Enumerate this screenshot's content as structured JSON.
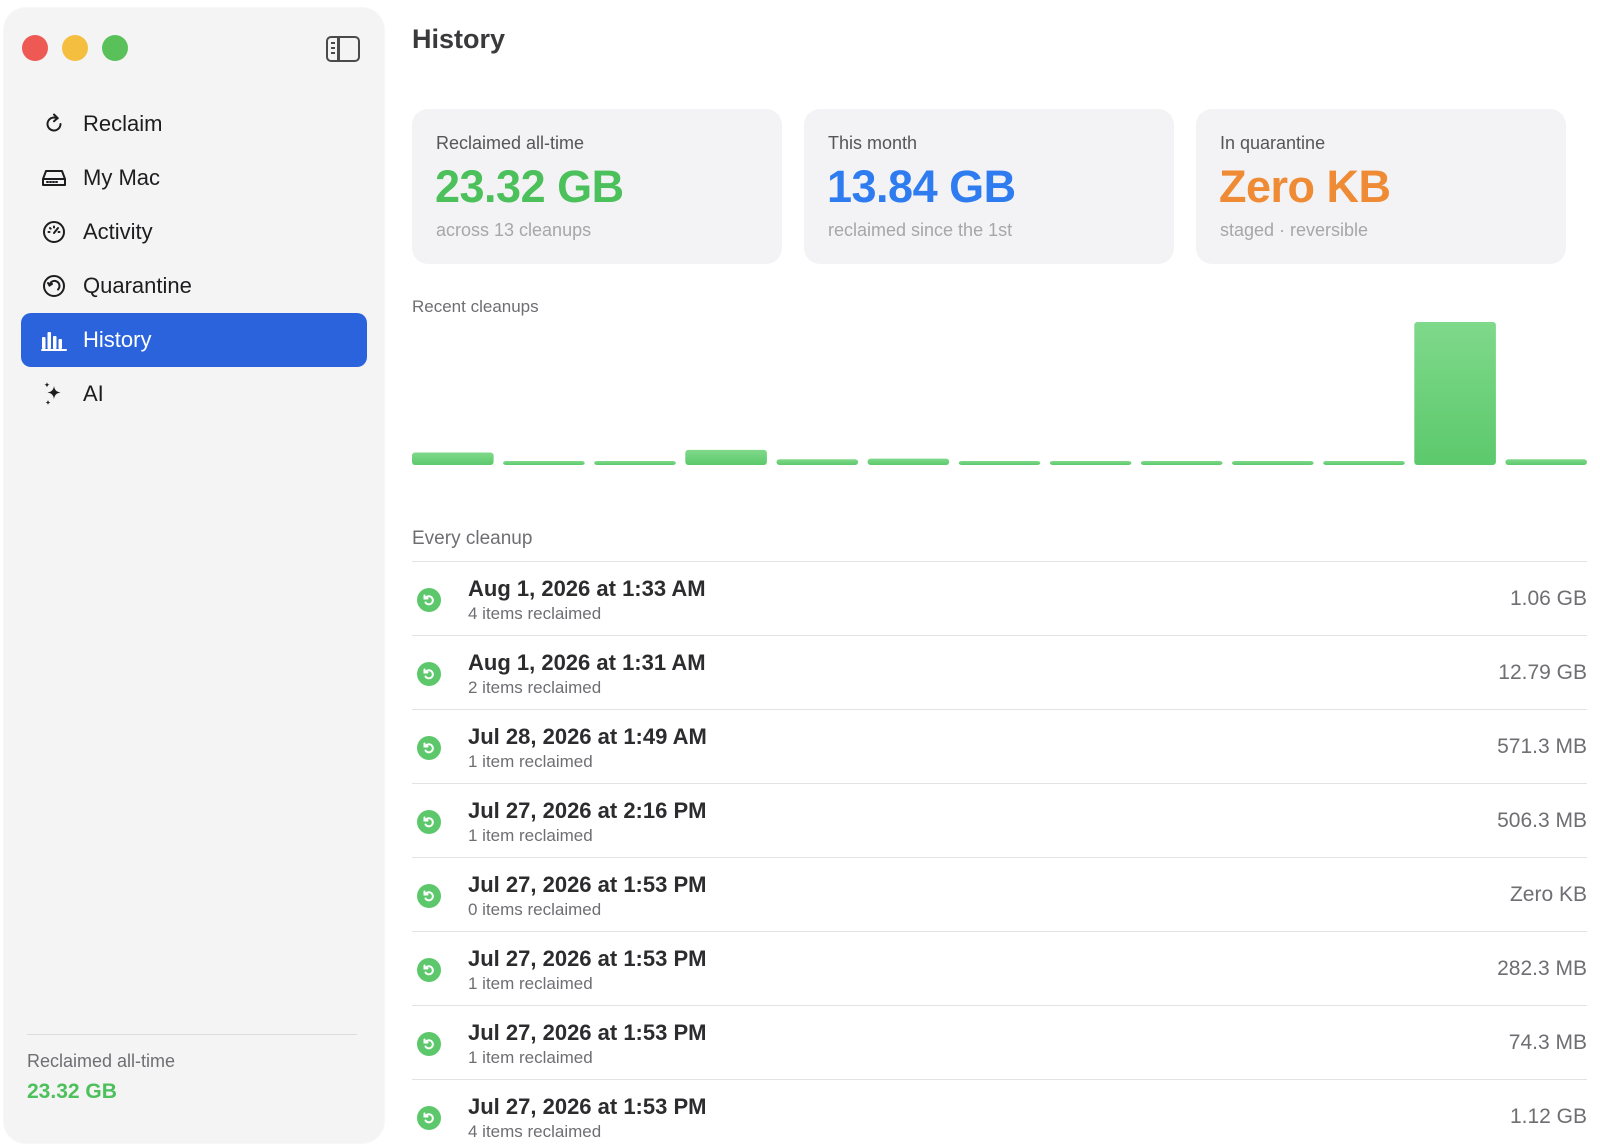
{
  "window": {
    "traffic_lights": [
      "close",
      "minimize",
      "zoom"
    ]
  },
  "sidebar": {
    "items": [
      {
        "label": "Reclaim",
        "icon": "refresh-icon",
        "active": false
      },
      {
        "label": "My Mac",
        "icon": "drive-icon",
        "active": false
      },
      {
        "label": "Activity",
        "icon": "gauge-icon",
        "active": false
      },
      {
        "label": "Quarantine",
        "icon": "restore-clock-icon",
        "active": false
      },
      {
        "label": "History",
        "icon": "bar-chart-icon",
        "active": true
      },
      {
        "label": "AI",
        "icon": "sparkles-icon",
        "active": false
      }
    ],
    "footer": {
      "label": "Reclaimed all-time",
      "value": "23.32 GB"
    }
  },
  "main": {
    "title": "History",
    "cards": [
      {
        "label": "Reclaimed all-time",
        "value": "23.32 GB",
        "sub": "across 13 cleanups",
        "color": "#4cc05b"
      },
      {
        "label": "This month",
        "value": "13.84 GB",
        "sub": "reclaimed since the 1st",
        "color": "#2f7cf0"
      },
      {
        "label": "In quarantine",
        "value": "Zero KB",
        "sub": "staged · reversible",
        "color": "#ef8a35"
      }
    ],
    "recent_label": "Recent cleanups",
    "every_label": "Every cleanup",
    "cleanups": [
      {
        "date": "Aug 1, 2026 at 1:33 AM",
        "count": "4 items reclaimed",
        "size": "1.06 GB"
      },
      {
        "date": "Aug 1, 2026 at 1:31 AM",
        "count": "2 items reclaimed",
        "size": "12.79 GB"
      },
      {
        "date": "Jul 28, 2026 at 1:49 AM",
        "count": "1 item reclaimed",
        "size": "571.3 MB"
      },
      {
        "date": "Jul 27, 2026 at 2:16 PM",
        "count": "1 item reclaimed",
        "size": "506.3 MB"
      },
      {
        "date": "Jul 27, 2026 at 1:53 PM",
        "count": "0 items reclaimed",
        "size": "Zero KB"
      },
      {
        "date": "Jul 27, 2026 at 1:53 PM",
        "count": "1 item reclaimed",
        "size": "282.3 MB"
      },
      {
        "date": "Jul 27, 2026 at 1:53 PM",
        "count": "1 item reclaimed",
        "size": "74.3 MB"
      },
      {
        "date": "Jul 27, 2026 at 1:53 PM",
        "count": "4 items reclaimed",
        "size": "1.12 GB"
      }
    ]
  },
  "chart_data": {
    "type": "bar",
    "title": "",
    "values_gb": [
      1.12,
      0.0743,
      0.2823,
      1.35,
      0.5063,
      0.5713,
      0.05,
      0.03,
      0.03,
      0.0743,
      0.0743,
      12.79,
      0.5063
    ],
    "ylim": [
      0,
      12.79
    ],
    "color": "#5cc96c",
    "color_top": "#7fd98a"
  }
}
